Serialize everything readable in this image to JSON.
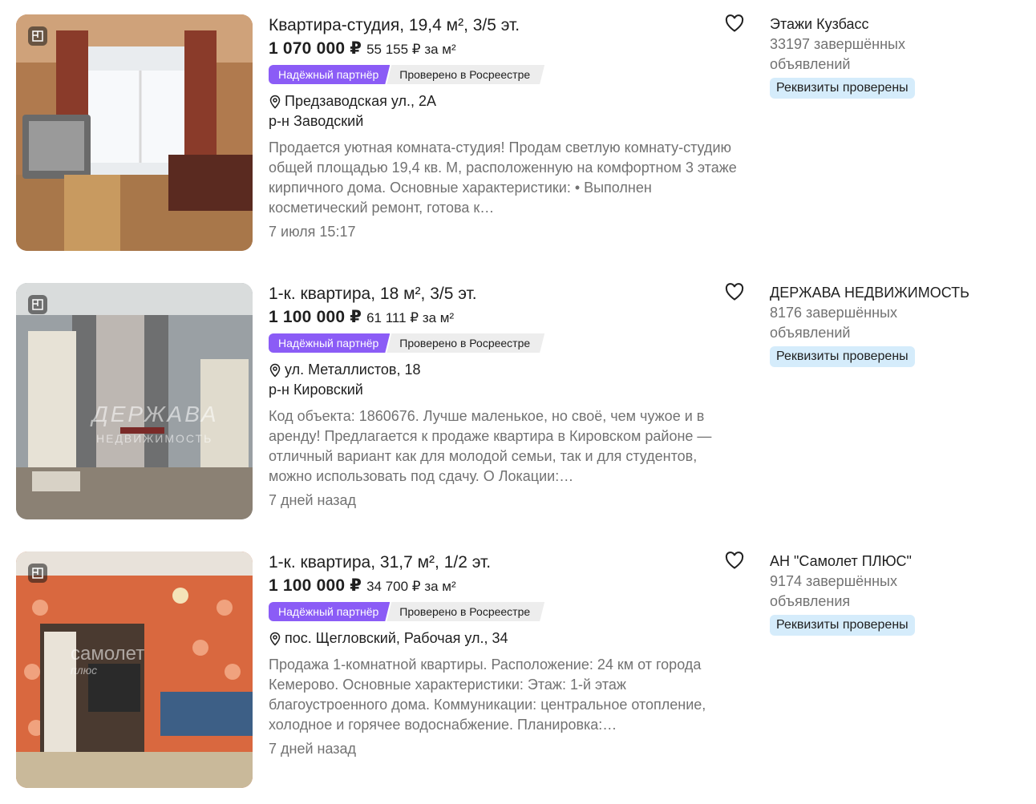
{
  "listings": [
    {
      "title": "Квартира-студия, 19,4 м², 3/5 эт.",
      "price": "1 070 000 ₽",
      "price_per_m": "55 155 ₽ за м²",
      "badge_partner": "Надёжный партнёр",
      "badge_check": "Проверено в Росреестре",
      "address": "Предзаводская ул., 2А",
      "district": "р-н Заводский",
      "description": "Продается уютная комната-студия! Продам светлую комнату-студию общей площадью 19,4 кв. М, расположенную на комфортном 3 этаже кирпичного дома. Основные характеристики: • Выполнен косметический ремонт, готова к…",
      "date": "7 июля 15:17",
      "seller_name": "Этажи Кузбасс",
      "seller_count": "33197 завершённых объявлений",
      "seller_verified": "Реквизиты проверены",
      "photo_icon": "floor-plan-icon"
    },
    {
      "title": "1-к. квартира, 18 м², 3/5 эт.",
      "price": "1 100 000 ₽",
      "price_per_m": "61 111 ₽ за м²",
      "badge_partner": "Надёжный партнёр",
      "badge_check": "Проверено в Росреестре",
      "address": "ул. Металлистов, 18",
      "district": "р-н Кировский",
      "description": "Код объекта: 1860676. Лучше маленькое, но своё, чем чужое и в аренду! Предлагается к продаже квартира в Кировском районе — отличный вариант как для молодой семьи, так и для студентов, можно использовать под сдачу. О Локации:…",
      "date": "7 дней назад",
      "seller_name": "ДЕРЖАВА НЕДВИЖИМОСТЬ",
      "seller_count": "8176 завершённых объявлений",
      "seller_verified": "Реквизиты проверены",
      "photo_watermark": "ДЕРЖАВА",
      "photo_watermark_sub": "НЕДВИЖИМОСТЬ",
      "photo_icon": "floor-plan-icon"
    },
    {
      "title": "1-к. квартира, 31,7 м², 1/2 эт.",
      "price": "1 100 000 ₽",
      "price_per_m": "34 700 ₽ за м²",
      "badge_partner": "Надёжный партнёр",
      "badge_check": "Проверено в Росреестре",
      "address": "пос. Щегловский, Рабочая ул., 34",
      "district": "",
      "description": "Продажа 1-комнатной квартиры. Расположение: 24 км от города Кемерово. Основные характеристики: Этаж: 1-й этаж благоустроенного дома. Коммуникации: центральное отопление, холодное и горячее водоснабжение. Планировка:…",
      "date": "7 дней назад",
      "seller_name": "АН \"Самолет ПЛЮС\"",
      "seller_count": "9174 завершённых объявления",
      "seller_verified": "Реквизиты проверены",
      "photo_watermark": "самолет",
      "photo_watermark_sub": "плюс",
      "photo_icon": "floor-plan-icon"
    }
  ],
  "colors": {
    "partner_badge": "#8b5cf6",
    "check_badge": "#ededed",
    "verified_badge": "#d5ecfb",
    "muted_text": "#727272"
  }
}
